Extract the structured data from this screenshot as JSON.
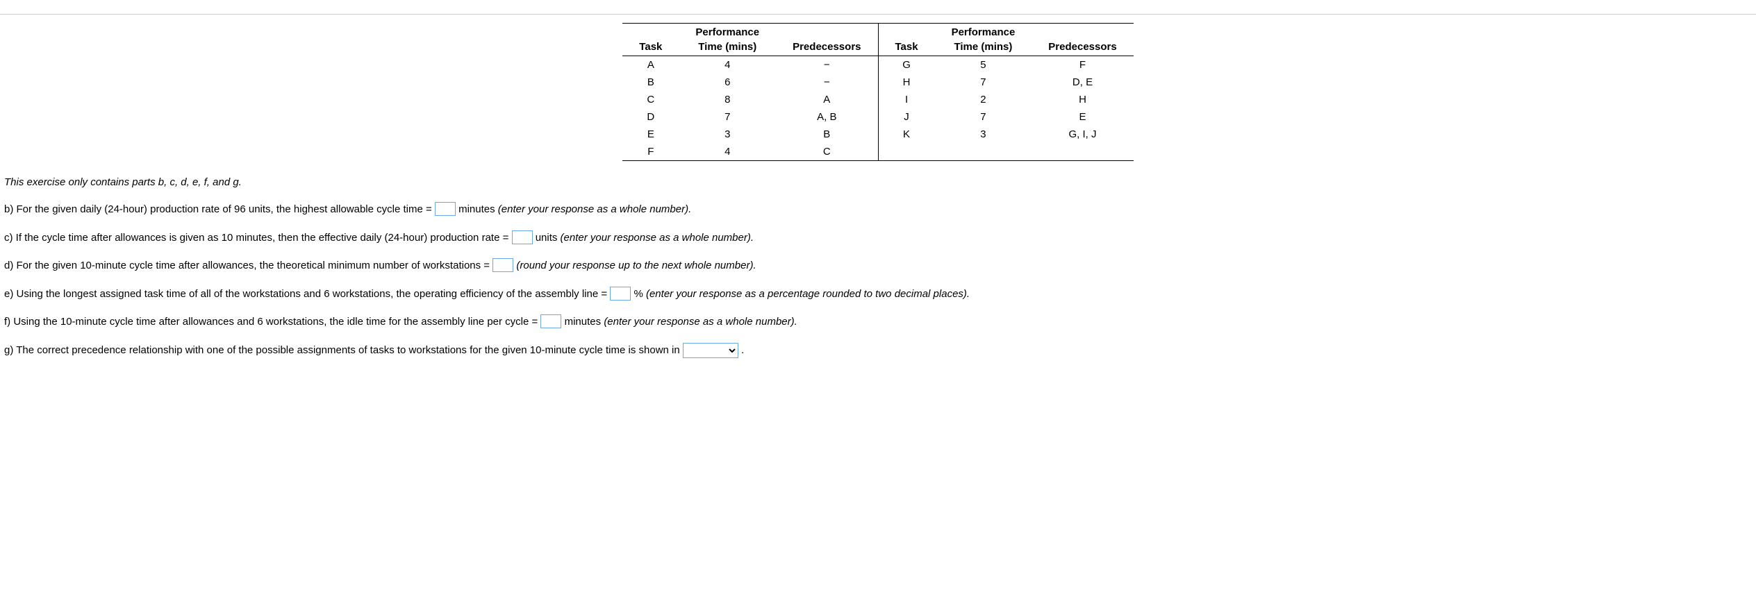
{
  "table": {
    "headers": {
      "task": "Task",
      "time": "Performance\nTime (mins)",
      "pred": "Predecessors"
    },
    "left": [
      {
        "task": "A",
        "time": "4",
        "pred": "−"
      },
      {
        "task": "B",
        "time": "6",
        "pred": "−"
      },
      {
        "task": "C",
        "time": "8",
        "pred": "A"
      },
      {
        "task": "D",
        "time": "7",
        "pred": "A, B"
      },
      {
        "task": "E",
        "time": "3",
        "pred": "B"
      },
      {
        "task": "F",
        "time": "4",
        "pred": "C"
      }
    ],
    "right": [
      {
        "task": "G",
        "time": "5",
        "pred": "F"
      },
      {
        "task": "H",
        "time": "7",
        "pred": "D, E"
      },
      {
        "task": "I",
        "time": "2",
        "pred": "H"
      },
      {
        "task": "J",
        "time": "7",
        "pred": "E"
      },
      {
        "task": "K",
        "time": "3",
        "pred": "G, I, J"
      },
      {
        "task": "",
        "time": "",
        "pred": ""
      }
    ]
  },
  "note": "This exercise only contains parts b, c, d, e, f, and g.",
  "questions": {
    "b": {
      "pre": "b) For the given daily (24-hour) production rate of 96 units, the highest allowable cycle time = ",
      "post": " minutes ",
      "hint": "(enter your response as a whole number)."
    },
    "c": {
      "pre": "c) If the cycle time after allowances is given as 10 minutes, then the effective daily (24-hour) production rate = ",
      "post": " units ",
      "hint": "(enter your response as a whole number)."
    },
    "d": {
      "pre": "d) For the given 10-minute cycle time after allowances, the theoretical minimum number of workstations = ",
      "post": " ",
      "hint": "(round your response up to the next whole number)."
    },
    "e": {
      "pre": "e) Using the longest assigned task time of all of the workstations and 6 workstations, the operating efficiency of the assembly line = ",
      "post": "% ",
      "hint": "(enter your response as a percentage rounded to two decimal places)."
    },
    "f": {
      "pre": "f) Using the 10-minute cycle time after allowances and 6 workstations, the idle time for the assembly line per cycle = ",
      "post": " minutes ",
      "hint": "(enter your response as a whole number)."
    },
    "g": {
      "pre": "g) The correct precedence relationship with one of the possible assignments of tasks to workstations for the given 10-minute cycle time is shown in ",
      "post": " ."
    }
  }
}
